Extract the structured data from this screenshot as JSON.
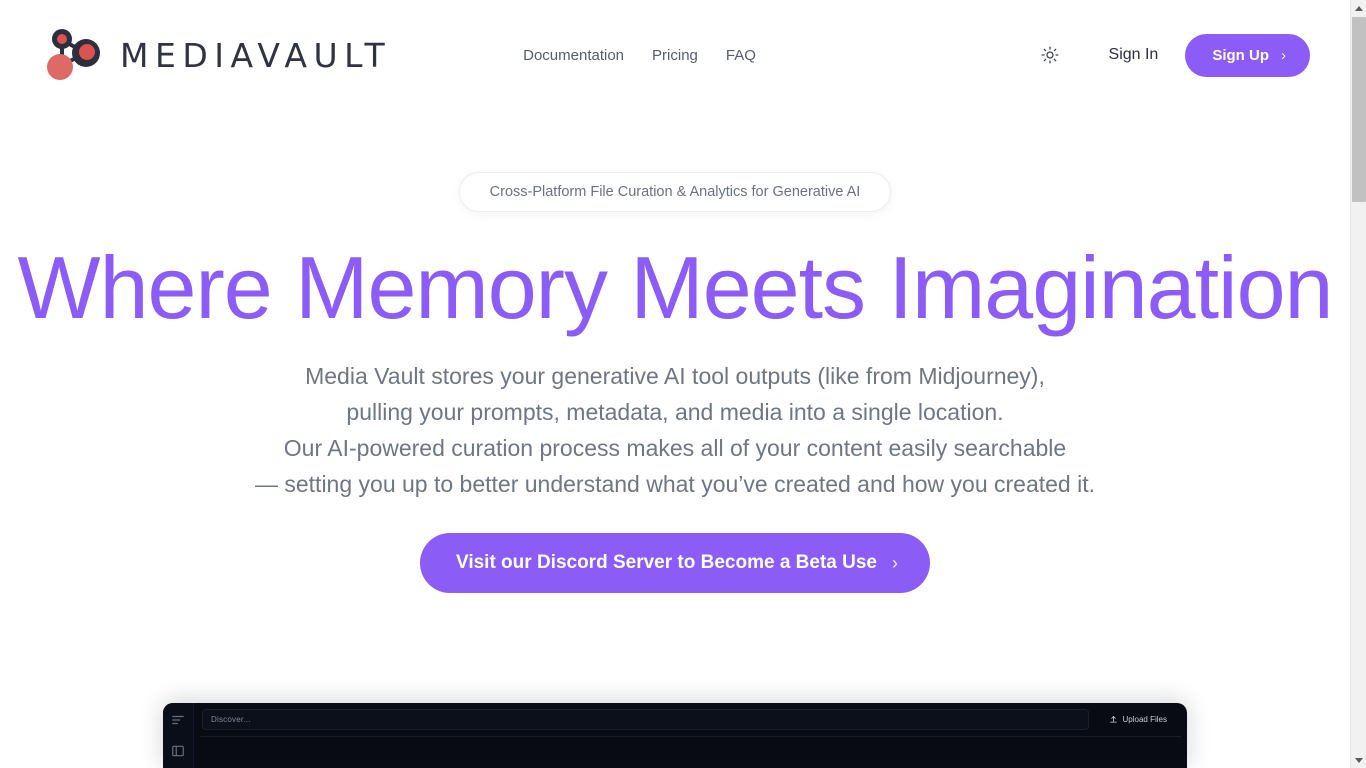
{
  "header": {
    "brand": {
      "wordmark": "MEDIAVAULT",
      "logo_icon": "molecule-node-graph-icon",
      "logo_node_dark": "#2b2f3e",
      "logo_node_red": "#d9534f"
    },
    "nav": [
      {
        "label": "Documentation",
        "name": "documentation"
      },
      {
        "label": "Pricing",
        "name": "pricing"
      },
      {
        "label": "FAQ",
        "name": "faq"
      }
    ],
    "theme_toggle_icon": "sun-icon",
    "sign_in_label": "Sign In",
    "sign_up_label": "Sign Up",
    "sign_up_chevron": "›"
  },
  "hero": {
    "badge": "Cross-Platform File Curation & Analytics for Generative AI",
    "headline": "Where Memory Meets Imagination",
    "subtitle_lines": [
      "Media Vault stores your generative AI tool outputs (like from Midjourney),",
      "pulling your prompts, metadata, and media into a single location.",
      "Our AI-powered curation process makes all of your content easily searchable",
      "— setting you up to better understand what you’ve created and how you created it."
    ],
    "cta_label": "Visit our Discord Server to Become a Beta Use",
    "cta_chevron": "›"
  },
  "app_preview": {
    "rail_icons": [
      "filter-sliders-icon",
      "panel-layout-icon"
    ],
    "search_placeholder": "Discover...",
    "upload_label": "Upload Files",
    "upload_icon": "upload-icon"
  },
  "colors": {
    "accent_purple": "#8b5cf6",
    "text_dark": "#2b2f3a",
    "text_muted": "#6f7683",
    "app_bg_dark": "#080b14"
  },
  "scrollbar": {
    "up_arrow": "scroll-up-arrow",
    "down_arrow": "scroll-down-arrow"
  }
}
